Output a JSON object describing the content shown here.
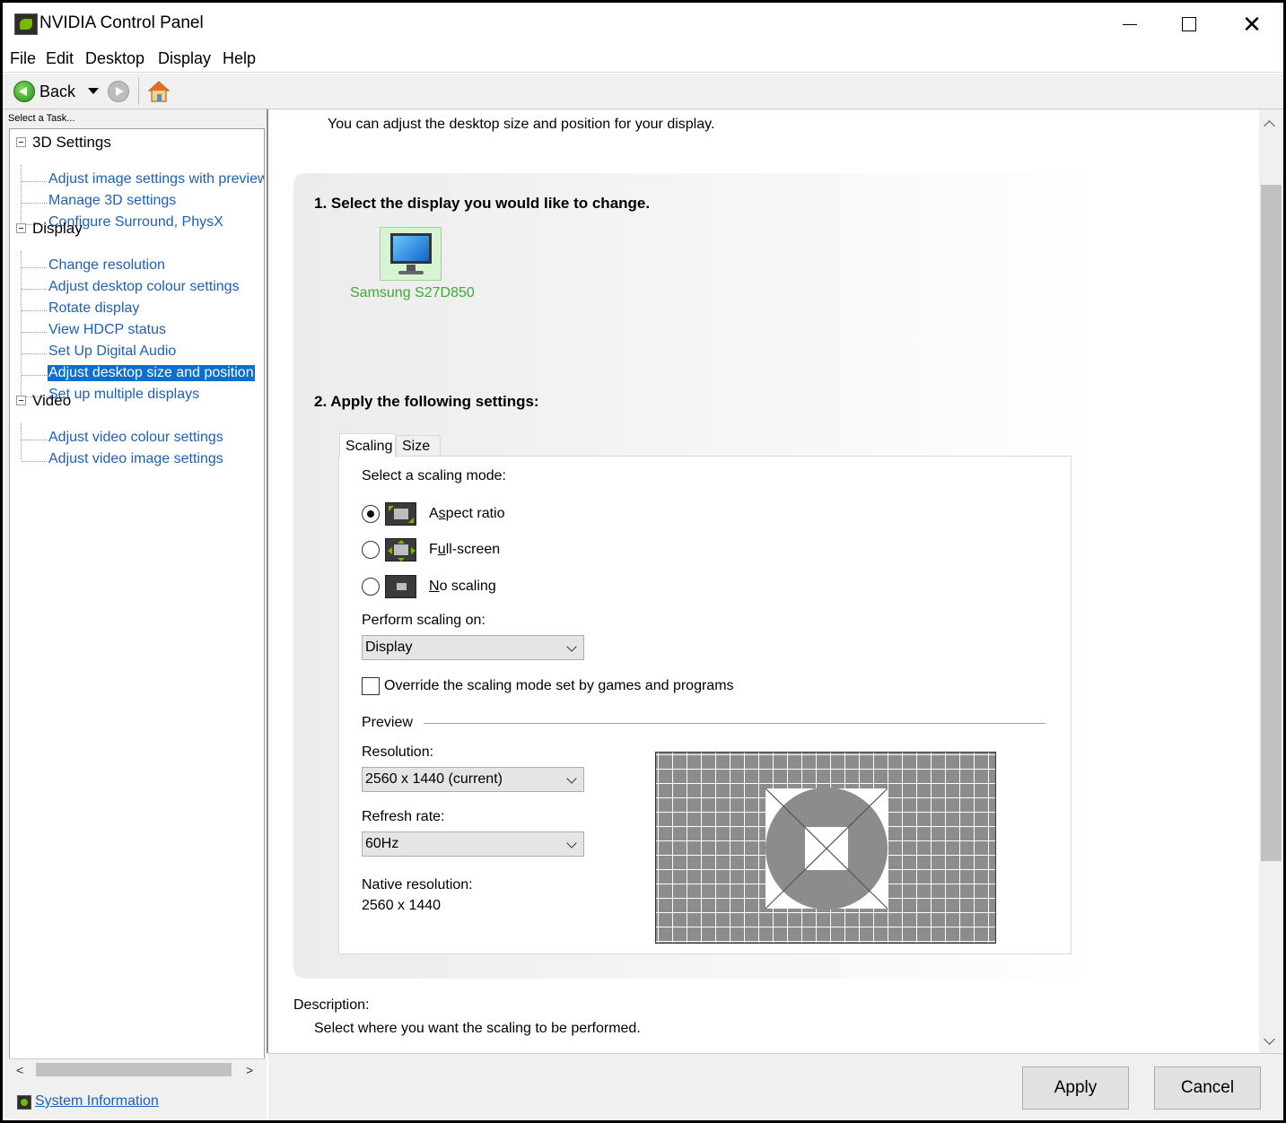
{
  "window": {
    "title": "NVIDIA Control Panel",
    "controls": {
      "minimize": "minimize-icon",
      "maximize": "maximize-icon",
      "close": "close-icon"
    },
    "close_glyph": "✕"
  },
  "menu": {
    "items": [
      "File",
      "Edit",
      "Desktop",
      "Display",
      "Help"
    ]
  },
  "toolbar": {
    "back_label": "Back",
    "icons": [
      "back-arrow-icon",
      "dropdown-icon",
      "forward-arrow-icon",
      "home-icon"
    ]
  },
  "left_panel": {
    "heading": "Select a Task...",
    "groups": [
      {
        "label": "3D Settings",
        "items": [
          "Adjust image settings with preview",
          "Manage 3D settings",
          "Configure Surround, PhysX"
        ]
      },
      {
        "label": "Display",
        "items": [
          "Change resolution",
          "Adjust desktop colour settings",
          "Rotate display",
          "View HDCP status",
          "Set Up Digital Audio",
          "Adjust desktop size and position",
          "Set up multiple displays"
        ]
      },
      {
        "label": "Video",
        "items": [
          "Adjust video colour settings",
          "Adjust video image settings"
        ]
      }
    ],
    "selected_item": "Adjust desktop size and position",
    "scroll_left": "<",
    "scroll_right": ">",
    "system_info": "System Information"
  },
  "content": {
    "intro": "You can adjust the desktop size and position for your display.",
    "step1": "1. Select the display you would like to change.",
    "display_name": "Samsung S27D850",
    "step2": "2. Apply the following settings:",
    "tabs": [
      "Scaling",
      "Size"
    ],
    "active_tab": "Scaling",
    "scaling_prompt": "Select a scaling mode:",
    "modes": [
      {
        "pre": "A",
        "ul": "s",
        "post": "pect ratio",
        "checked": true
      },
      {
        "pre": "F",
        "ul": "u",
        "post": "ll-screen",
        "checked": false
      },
      {
        "pre": "",
        "ul": "N",
        "post": "o scaling",
        "checked": false
      }
    ],
    "perform_on_label": "Perform scaling on:",
    "perform_on_value": "Display",
    "override_label": "Override the scaling mode set by games and programs",
    "override_checked": false,
    "preview_label": "Preview",
    "resolution_label": "Resolution:",
    "resolution_value": "2560 x 1440 (current)",
    "refresh_label": "Refresh rate:",
    "refresh_value": "60Hz",
    "native_label": "Native resolution:",
    "native_value": "2560 x 1440",
    "description_label": "Description:",
    "description_text": "Select where you want the scaling to be performed."
  },
  "buttons": {
    "apply": "Apply",
    "cancel": "Cancel"
  }
}
